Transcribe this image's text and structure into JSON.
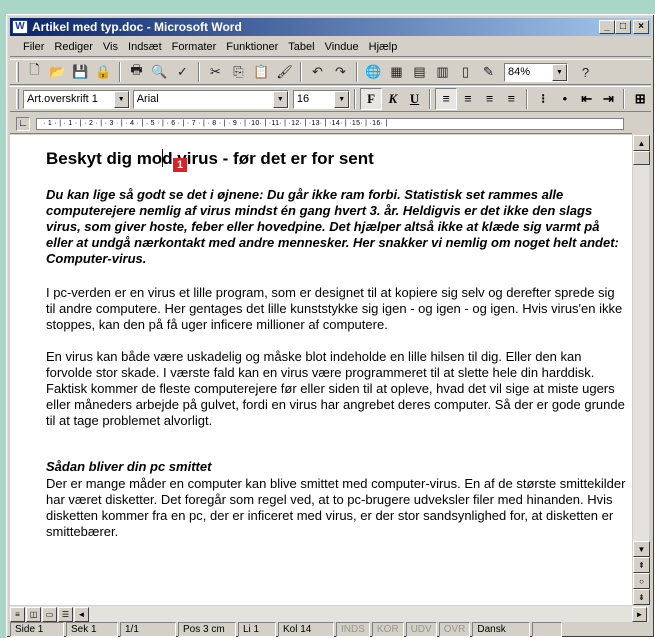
{
  "window": {
    "title": "Artikel med typ.doc - Microsoft Word",
    "app_icon": "word-doc-icon",
    "controls": [
      "_",
      "□",
      "×"
    ]
  },
  "menu": [
    "Filer",
    "Rediger",
    "Vis",
    "Indsæt",
    "Formater",
    "Funktioner",
    "Tabel",
    "Vindue",
    "Hjælp"
  ],
  "standard_toolbar": {
    "zoom": "84%",
    "icons": [
      "new-icon",
      "open-icon",
      "save-icon",
      "permission-icon",
      "print-icon",
      "print-preview-icon",
      "spelling-icon",
      "cut-icon",
      "copy-icon",
      "paste-icon",
      "format-painter-icon",
      "undo-icon",
      "redo-icon",
      "hyperlink-icon",
      "tables-borders-icon",
      "insert-table-icon",
      "insert-excel-icon",
      "columns-icon",
      "drawing-icon",
      "help-icon"
    ]
  },
  "formatting_toolbar": {
    "style": "Art.overskrift 1",
    "font": "Arial",
    "size": "16",
    "bold": "F",
    "italic": "K",
    "underline": "U"
  },
  "ruler": {
    "marks": "· 1 · | · 1 · | · 2 · | · 3 · | · 4 · | · 5 · | · 6 · | · 7 · | · 8 · | · 9 · | ·10· | ·11· | ·12· | ·13· | ·14· | ·15· | ·16· |"
  },
  "document": {
    "heading_before_cursor": "Beskyt dig mo",
    "heading_after_cursor": "d virus - før det er for sent",
    "marker": "1",
    "lead": "Du kan lige så godt se det i øjnene: Du går ikke ram forbi. Statistisk set rammes alle computerejere nemlig af virus mindst én gang hvert 3. år. Heldigvis er det ikke den slags virus, som giver hoste, feber eller hovedpine. Det hjælper altså ikke at klæde sig varmt på eller at undgå nærkontakt med andre mennesker. Her snakker vi nemlig om noget helt andet: Computer-virus.",
    "paragraph_1": "I pc-verden er en virus et lille program, som er designet til at kopiere sig selv og derefter sprede sig til andre computere. Her gentages det lille kunststykke sig igen - og igen - og igen. Hvis virus'en ikke stoppes, kan den på få uger inficere millioner af computere.",
    "paragraph_2": "En virus kan både være uskadelig og måske blot indeholde en lille hilsen til dig. Eller den kan forvolde stor skade. I værste fald kan en virus være programmeret til at slette hele din harddisk. Faktisk kommer de fleste computerejere før eller siden til at opleve, hvad det vil sige at miste ugers eller måneders arbejde på gulvet, fordi en virus har angrebet deres computer. Så der er gode grunde til at tage problemet alvorligt.",
    "subheading": "Sådan bliver din pc smittet",
    "paragraph_3": "Der er mange måder en computer kan blive smittet med computer-virus. En af de største smittekilder har været disketter. Det foregår som regel ved, at to pc-brugere udveksler filer med hinanden. Hvis disketten kommer fra en pc, der er inficeret med virus, er der stor sandsynlighed for, at disketten er smittebærer."
  },
  "statusbar": {
    "side": "Side 1",
    "sek": "Sek 1",
    "pages": "1/1",
    "pos": "Pos 3 cm",
    "li": "Li 1",
    "kol": "Kol 14",
    "inds": "INDS",
    "kor": "KOR",
    "udv": "UDV",
    "ovr": "OVR",
    "language": "Dansk"
  }
}
